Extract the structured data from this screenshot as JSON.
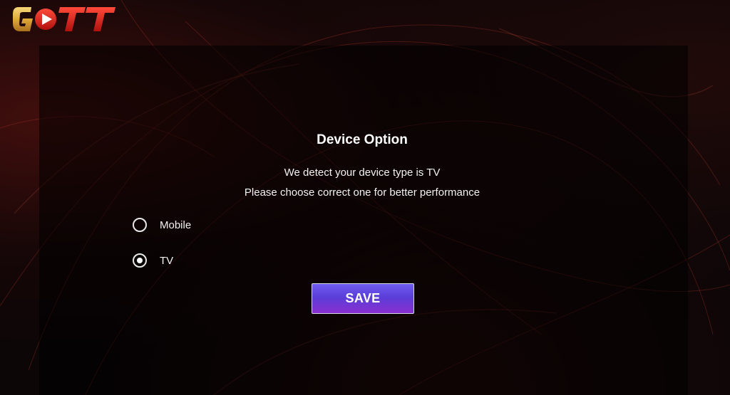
{
  "app": {
    "logo_text": "GOTT"
  },
  "dialog": {
    "title": "Device Option",
    "message_line1": "We detect your device type is TV",
    "message_line2": "Please choose correct one for better performance",
    "options": [
      {
        "label": "Mobile",
        "selected": false
      },
      {
        "label": "TV",
        "selected": true
      }
    ],
    "save_label": "SAVE"
  },
  "colors": {
    "button_top": "#6f5cf0",
    "button_bottom": "#8a2ed0",
    "logo_gold": "#e8b64a",
    "logo_red": "#d8201c",
    "text": "#ffffff"
  }
}
